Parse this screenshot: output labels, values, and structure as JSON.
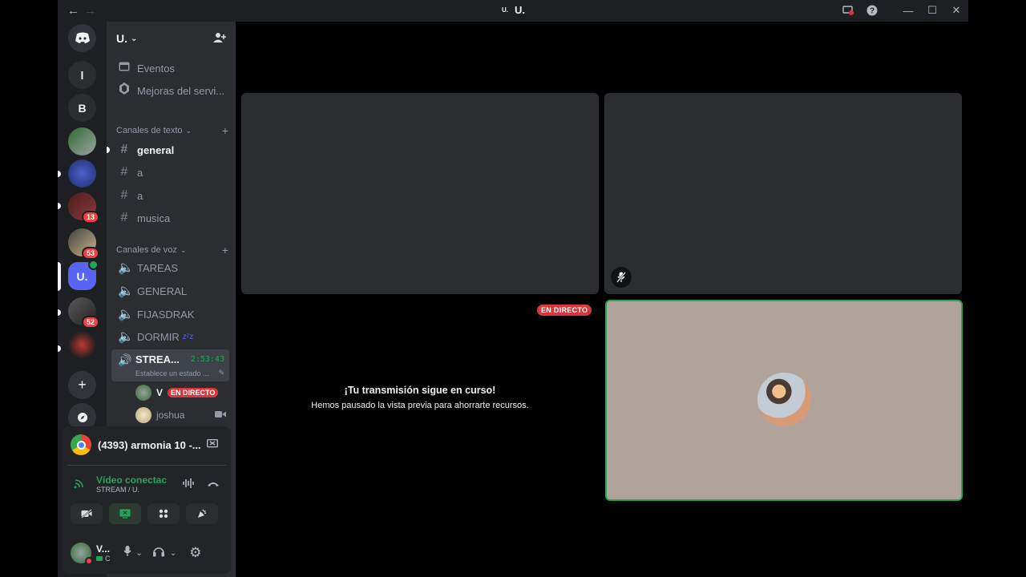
{
  "window": {
    "title": "U.",
    "title_mini": "U."
  },
  "servers": [
    {
      "label": "l"
    },
    {
      "label": "B"
    },
    {
      "badge": "13"
    },
    {
      "badge": "53"
    },
    {
      "label": "U."
    },
    {
      "badge": "52"
    }
  ],
  "sidebar": {
    "server_name": "U.",
    "events_label": "Eventos",
    "boosts_label": "Mejoras del servi...",
    "text_category": "Canales de texto",
    "text_channels": [
      "general",
      "a",
      "a",
      "musica"
    ],
    "voice_category": "Canales de voz",
    "voice_channels": [
      "TAREAS",
      "GENERAL",
      "FIJASDRAK",
      "DORMIR"
    ],
    "dormir_suffix": "zᶻz",
    "stream_channel": {
      "name": "STREA...",
      "timer": "2:53:43",
      "status": "Establece un estado ..."
    },
    "members": [
      {
        "name": "V",
        "live": "EN DIRECTO"
      },
      {
        "name": "joshua"
      }
    ]
  },
  "panel": {
    "stream_title": "(4393) armonia 10 -...",
    "voice_status": "Vídeo conectac",
    "voice_location": "STREAM / U.",
    "user_name": "V...",
    "user_status": "C"
  },
  "stage": {
    "live_badge": "EN DIRECTO",
    "paused_title": "¡Tu transmisión sigue en curso!",
    "paused_sub": "Hemos pausado la vista previa para ahorrarte recursos."
  },
  "colors": {
    "accent": "#5865f2",
    "live": "#da373c",
    "connected": "#23a55a"
  }
}
